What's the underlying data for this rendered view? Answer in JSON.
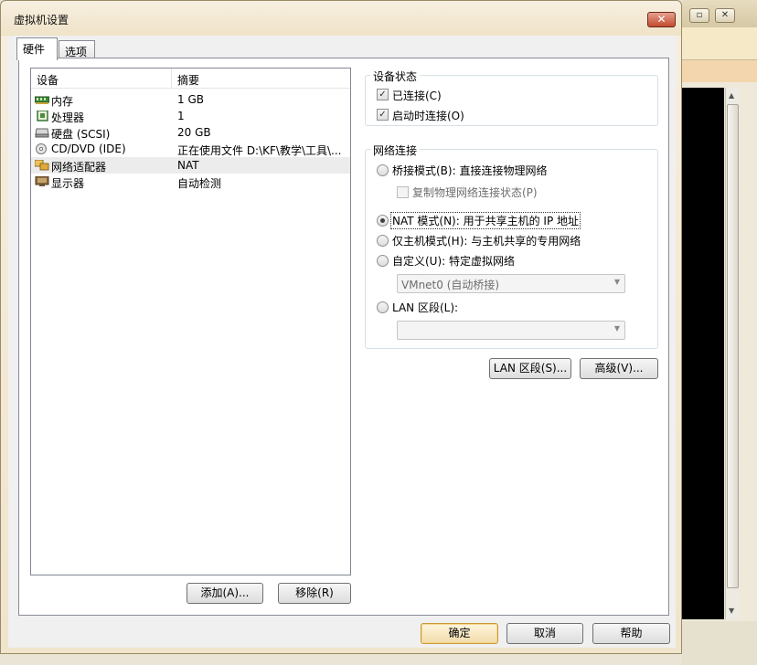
{
  "dialog": {
    "title": "虚拟机设置",
    "close_label": "✕"
  },
  "tabs": [
    {
      "label": "硬件"
    },
    {
      "label": "选项"
    }
  ],
  "device_list": {
    "col_device": "设备",
    "col_summary": "摘要",
    "items": [
      {
        "name": "内存",
        "summary": "1 GB",
        "icon": "memory-icon"
      },
      {
        "name": "处理器",
        "summary": "1",
        "icon": "processor-icon"
      },
      {
        "name": "硬盘 (SCSI)",
        "summary": "20 GB",
        "icon": "hard-disk-icon"
      },
      {
        "name": "CD/DVD (IDE)",
        "summary": "正在使用文件 D:\\KF\\教学\\工具\\...",
        "icon": "cd-dvd-icon"
      },
      {
        "name": "网络适配器",
        "summary": "NAT",
        "icon": "network-adapter-icon",
        "selected": true
      },
      {
        "name": "显示器",
        "summary": "自动检测",
        "icon": "display-icon"
      }
    ],
    "add_label": "添加(A)...",
    "remove_label": "移除(R)"
  },
  "device_status": {
    "title": "设备状态",
    "connected": {
      "label": "已连接(C)",
      "checked": true
    },
    "connect_at_power_on": {
      "label": "启动时连接(O)",
      "checked": true
    }
  },
  "network": {
    "title": "网络连接",
    "bridged": {
      "label": "桥接模式(B): 直接连接物理网络",
      "selected": false
    },
    "replicate": {
      "label": "复制物理网络连接状态(P)",
      "checked": false
    },
    "nat": {
      "label": "NAT 模式(N): 用于共享主机的 IP 地址",
      "selected": true
    },
    "host_only": {
      "label": "仅主机模式(H): 与主机共享的专用网络",
      "selected": false
    },
    "custom": {
      "label": "自定义(U): 特定虚拟网络",
      "selected": false,
      "value": "VMnet0 (自动桥接)"
    },
    "lan_segment": {
      "label": "LAN 区段(L):",
      "selected": false,
      "value": ""
    },
    "lan_segments_button": "LAN 区段(S)...",
    "advanced_button": "高级(V)..."
  },
  "footer": {
    "ok": "确定",
    "cancel": "取消",
    "help": "帮助"
  },
  "colors": {
    "selected_row": "#ececec",
    "default_button_border": "#c99a3a",
    "close_button": "#c24a2e"
  }
}
